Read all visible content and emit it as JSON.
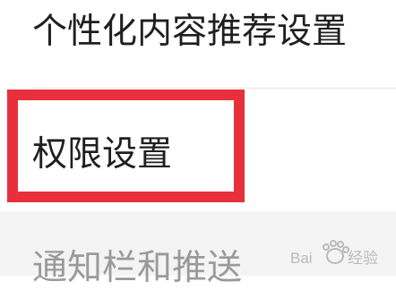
{
  "settings": {
    "items": [
      {
        "label": "个性化内容推荐设置"
      },
      {
        "label": "权限设置",
        "highlighted": true
      },
      {
        "label": "通知栏和推送"
      }
    ]
  },
  "highlight_color": "#e8303a",
  "watermark": {
    "text": "Baidu经验"
  }
}
